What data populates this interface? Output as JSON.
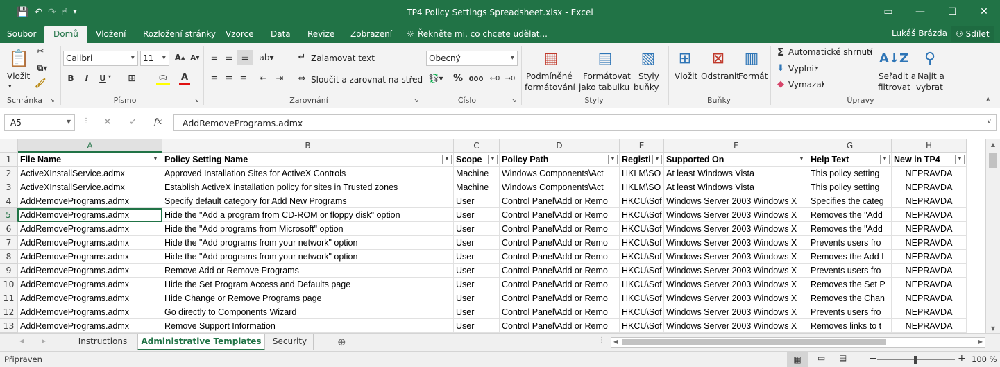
{
  "window": {
    "title": "TP4 Policy Settings Spreadsheet.xlsx - Excel",
    "controls": [
      "▭",
      "—",
      "☐",
      "✕"
    ]
  },
  "qat": {
    "save": "💾",
    "undo": "↶",
    "redo": "↷",
    "touch": "☝",
    "more": "▾"
  },
  "tabs": [
    "Soubor",
    "Domů",
    "Vložení",
    "Rozložení stránky",
    "Vzorce",
    "Data",
    "Revize",
    "Zobrazení"
  ],
  "tellme": "Řekněte mi, co chcete udělat...",
  "user": "Lukáš Brázda",
  "share": "Sdílet",
  "ribbon": {
    "clipboard": {
      "paste": "Vložit",
      "group": "Schránka"
    },
    "font": {
      "name": "Calibri",
      "size": "11",
      "bold": "B",
      "italic": "I",
      "underline": "U",
      "group": "Písmo"
    },
    "alignment": {
      "wrap": "Zalamovat text",
      "merge": "Sloučit a zarovnat na střed",
      "group": "Zarovnání"
    },
    "number": {
      "format": "Obecný",
      "percent": "%",
      "thousands": "000",
      "group": "Číslo"
    },
    "styles": {
      "conditional_1": "Podmíněné",
      "conditional_2": "formátování",
      "table_1": "Formátovat",
      "table_2": "jako tabulku",
      "cell_1": "Styly",
      "cell_2": "buňky",
      "group": "Styly"
    },
    "cells": {
      "insert": "Vložit",
      "delete": "Odstranit",
      "format": "Formát",
      "group": "Buňky"
    },
    "editing": {
      "autosum": "Automatické shrnutí",
      "fill": "Vyplnit",
      "clear": "Vymazat",
      "sort_1": "Seřadit a",
      "sort_2": "filtrovat",
      "find_1": "Najít a",
      "find_2": "vybrat",
      "group": "Úpravy"
    }
  },
  "formula_bar": {
    "name_box": "A5",
    "fx": "fx",
    "value": "AddRemovePrograms.admx"
  },
  "columns": [
    "A",
    "B",
    "C",
    "D",
    "E",
    "F",
    "G",
    "H"
  ],
  "rows": [
    "1",
    "2",
    "3",
    "4",
    "5",
    "6",
    "7",
    "8",
    "9",
    "10",
    "11",
    "12",
    "13"
  ],
  "table": {
    "headers": [
      "File Name",
      "Policy Setting Name",
      "Scope",
      "Policy Path",
      "Registi",
      "Supported On",
      "Help Text",
      "New in TP4"
    ],
    "rows": [
      [
        "ActiveXInstallService.admx",
        "Approved Installation Sites for ActiveX Controls",
        "Machine",
        "Windows Components\\Act",
        "HKLM\\SO",
        "At least Windows Vista",
        "This policy setting",
        "NEPRAVDA"
      ],
      [
        "ActiveXInstallService.admx",
        "Establish ActiveX installation policy for sites in Trusted zones",
        "Machine",
        "Windows Components\\Act",
        "HKLM\\SO",
        "At least Windows Vista",
        "This policy setting",
        "NEPRAVDA"
      ],
      [
        "AddRemovePrograms.admx",
        "Specify default category for Add New Programs",
        "User",
        "Control Panel\\Add or Remo",
        "HKCU\\Sof",
        "Windows Server 2003 Windows X",
        "Specifies the categ",
        "NEPRAVDA"
      ],
      [
        "AddRemovePrograms.admx",
        "Hide the \"Add a program from CD-ROM or floppy disk\" option",
        "User",
        "Control Panel\\Add or Remo",
        "HKCU\\Sof",
        "Windows Server 2003 Windows X",
        "Removes the \"Add",
        "NEPRAVDA"
      ],
      [
        "AddRemovePrograms.admx",
        "Hide the \"Add programs from Microsoft\" option",
        "User",
        "Control Panel\\Add or Remo",
        "HKCU\\Sof",
        "Windows Server 2003 Windows X",
        "Removes the \"Add",
        "NEPRAVDA"
      ],
      [
        "AddRemovePrograms.admx",
        "Hide the \"Add programs from your network\" option",
        "User",
        "Control Panel\\Add or Remo",
        "HKCU\\Sof",
        "Windows Server 2003 Windows X",
        "Prevents users fro",
        "NEPRAVDA"
      ],
      [
        "AddRemovePrograms.admx",
        "Hide the \"Add programs from your network\" option",
        "User",
        "Control Panel\\Add or Remo",
        "HKCU\\Sof",
        "Windows Server 2003 Windows X",
        "Removes the Add I",
        "NEPRAVDA"
      ],
      [
        "AddRemovePrograms.admx",
        "Remove Add or Remove Programs",
        "User",
        "Control Panel\\Add or Remo",
        "HKCU\\Sof",
        "Windows Server 2003 Windows X",
        "Prevents users fro",
        "NEPRAVDA"
      ],
      [
        "AddRemovePrograms.admx",
        "Hide the Set Program Access and Defaults page",
        "User",
        "Control Panel\\Add or Remo",
        "HKCU\\Sof",
        "Windows Server 2003 Windows X",
        "Removes the Set P",
        "NEPRAVDA"
      ],
      [
        "AddRemovePrograms.admx",
        "Hide Change or Remove Programs page",
        "User",
        "Control Panel\\Add or Remo",
        "HKCU\\Sof",
        "Windows Server 2003 Windows X",
        "Removes the Chan",
        "NEPRAVDA"
      ],
      [
        "AddRemovePrograms.admx",
        "Go directly to Components Wizard",
        "User",
        "Control Panel\\Add or Remo",
        "HKCU\\Sof",
        "Windows Server 2003 Windows X",
        "Prevents users fro",
        "NEPRAVDA"
      ],
      [
        "AddRemovePrograms.admx",
        "Remove Support Information",
        "User",
        "Control Panel\\Add or Remo",
        "HKCU\\Sof",
        "Windows Server 2003 Windows X",
        "Removes links to t",
        "NEPRAVDA"
      ]
    ]
  },
  "sheets": {
    "tabs": [
      "Instructions",
      "Administrative Templates",
      "Security"
    ],
    "active": "Administrative Templates",
    "add": "⊕"
  },
  "status": {
    "ready": "Připraven",
    "zoom": "100 %",
    "zoom_out": "−",
    "zoom_in": "+"
  },
  "colors": {
    "brand": "#217346"
  }
}
